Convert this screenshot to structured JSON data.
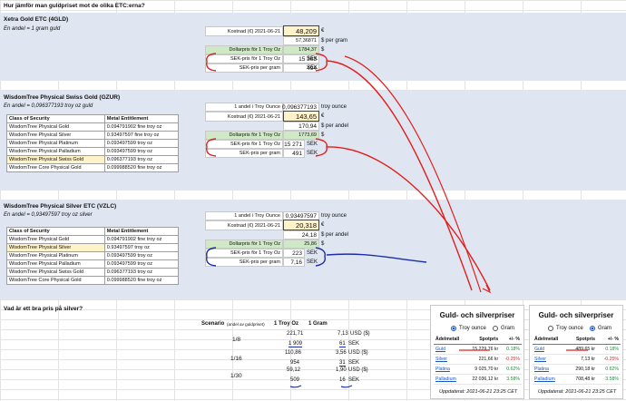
{
  "question": "Hur jämför man guldpriset mot de olika ETC:erna?",
  "gld": {
    "title": "Xetra Gold ETC (4GLD)",
    "subtitle": "En andel = 1 gram guld",
    "cost_label": "Kostnad (€) 2021-06-21",
    "cost_value": "48,209",
    "cost_unit": "€",
    "per_gram_value": "57,36871",
    "per_gram_unit": "$ per gram",
    "dollar_label": "Dollarpris för 1 Troy Oz",
    "dollar_value": "1784,37",
    "dollar_unit": "$",
    "sek_oz_label": "SEK-pris för 1 Troy Oz",
    "sek_oz_value": "15 363",
    "sek_oz_unit": "SEK",
    "sek_gram_label": "SEK-pris per gram",
    "sek_gram_value": "494",
    "sek_gram_unit": "SEK"
  },
  "gzur": {
    "title": "WisdomTree Physical Swiss Gold (GZUR)",
    "subtitle": "En andel = 0,096377193 troy oz guld",
    "share_label": "1 andel i Troy Ounce",
    "share_value": "0,096377193",
    "share_unit": "troy ounce",
    "cost_label": "Kostnad (€) 2021-06-21",
    "cost_value": "143,65",
    "cost_unit": "€",
    "per_gram_value": "170,94",
    "per_gram_unit": "$ per andel",
    "dollar_label": "Dollarpris för 1 Troy Oz",
    "dollar_value": "1773,69",
    "dollar_unit": "$",
    "sek_oz_label": "SEK-pris för 1 Troy Oz",
    "sek_oz_value": "15 271",
    "sek_oz_unit": "SEK",
    "sek_gram_label": "SEK-pris per gram",
    "sek_gram_value": "491",
    "sek_gram_unit": "SEK",
    "table": {
      "headers": [
        "Class of Security",
        "Metal Entitlement"
      ],
      "rows": [
        [
          "WisdomTree Physical Gold",
          "0.094791902 fine troy oz"
        ],
        [
          "WisdomTree Physical Silver",
          "0.93497597 fine troy oz"
        ],
        [
          "WisdomTree Physical Platinum",
          "0.093497599 troy oz"
        ],
        [
          "WisdomTree Physical Palladium",
          "0.093497599 troy oz"
        ],
        [
          "WisdomTree Physical Swiss Gold",
          "0.096377193 troy oz"
        ],
        [
          "WisdomTree Core Physical Gold",
          "0.099988520 fine troy oz"
        ]
      ]
    }
  },
  "vzlc": {
    "title": "WisdomTree Physical Silver ETC (VZLC)",
    "subtitle": "En andel = 0,93497597 troy oz silver",
    "share_label": "1 andel i Troy Ounce",
    "share_value": "0,93497597",
    "share_unit": "troy ounce",
    "cost_label": "Kostnad (€) 2021-06-21",
    "cost_value": "20,318",
    "cost_unit": "€",
    "per_gram_value": "24,18",
    "per_gram_unit": "$ per andel",
    "dollar_label": "Dollarpris för 1 Troy Oz",
    "dollar_value": "25,86",
    "dollar_unit": "$",
    "sek_oz_label": "SEK-pris för 1 Troy Oz",
    "sek_oz_value": "223",
    "sek_oz_unit": "SEK",
    "sek_gram_label": "SEK-pris per gram",
    "sek_gram_value": "7,16",
    "sek_gram_unit": "SEK",
    "table": {
      "headers": [
        "Class of Security",
        "Metal Entitlement"
      ],
      "rows": [
        [
          "WisdomTree Physical Gold",
          "0.094791902 fine troy oz"
        ],
        [
          "WisdomTree Physical Silver",
          "0.93497597 troy oz"
        ],
        [
          "WisdomTree Physical Platinum",
          "0.093497599 troy oz"
        ],
        [
          "WisdomTree Physical Palladium",
          "0.093497599 troy oz"
        ],
        [
          "WisdomTree Physical Swiss Gold",
          "0.096377193 troy oz"
        ],
        [
          "WisdomTree Core Physical Gold",
          "0.099988520 fine troy oz"
        ]
      ]
    }
  },
  "scenario": {
    "question": "Vad är ett bra pris på silver?",
    "header_scenario": "Scenario",
    "header_note": "(andel av guldpriset)",
    "header_troy": "1 Troy Oz",
    "header_gram": "1 Gram",
    "rows": [
      {
        "label": "1/8",
        "troy_usd": "221,71",
        "troy_sek": "1 909",
        "gram_usd": "7,13",
        "gram_usd_unit": "USD ($)",
        "gram_sek": "61",
        "gram_sek_unit": "SEK"
      },
      {
        "label": "1/16",
        "troy_usd": "110,86",
        "troy_sek": "954",
        "gram_usd": "3,56",
        "gram_usd_unit": "USD ($)",
        "gram_sek": "31",
        "gram_sek_unit": "SEK"
      },
      {
        "label": "1/30",
        "troy_usd": "59,12",
        "troy_sek": "509",
        "gram_usd": "1,90",
        "gram_usd_unit": "USD ($)",
        "gram_sek": "16",
        "gram_sek_unit": "SEK"
      }
    ]
  },
  "widget_left": {
    "title": "Guld- och silverpriser",
    "radio_troy": "Troy ounce",
    "radio_gram": "Gram",
    "col_metal": "Ädelmetall",
    "col_price": "Spotpris",
    "col_change": "+/- %",
    "rows": [
      {
        "metal": "Guld",
        "price": "15 229,76 kr",
        "change": "0.18%",
        "dir": "pos"
      },
      {
        "metal": "Silver",
        "price": "221,66 kr",
        "change": "-0.25%",
        "dir": "neg"
      },
      {
        "metal": "Platina",
        "price": "9 025,70 kr",
        "change": "0.62%",
        "dir": "pos"
      },
      {
        "metal": "Palladium",
        "price": "22 036,12 kr",
        "change": "3.58%",
        "dir": "pos"
      }
    ],
    "updated": "Uppdaterat: 2021-06-21 23:25 CET"
  },
  "widget_right": {
    "title": "Guld- och silverpriser",
    "radio_troy": "Troy ounce",
    "radio_gram": "Gram",
    "col_metal": "Ädelmetall",
    "col_price": "Spotpris",
    "col_change": "+/- %",
    "rows": [
      {
        "metal": "Guld",
        "price": "489,65 kr",
        "change": "0.18%",
        "dir": "pos"
      },
      {
        "metal": "Silver",
        "price": "7,13 kr",
        "change": "-0.25%",
        "dir": "neg"
      },
      {
        "metal": "Platina",
        "price": "290,18 kr",
        "change": "0.62%",
        "dir": "pos"
      },
      {
        "metal": "Palladium",
        "price": "708,48 kr",
        "change": "3.58%",
        "dir": "pos"
      }
    ],
    "updated": "Uppdaterat: 2021-06-21 23:25 CET"
  },
  "colors": {
    "band": "#dfe5f1",
    "green": "#cfe9c6",
    "yellow": "#fdf2c8",
    "red_ink": "#e0201c",
    "blue_ink": "#1c2fa8"
  }
}
